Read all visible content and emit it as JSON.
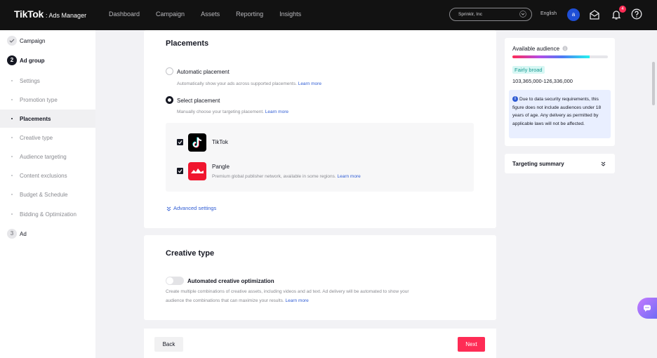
{
  "topbar": {
    "brand": "TikTok",
    "sub": ": Ads Manager",
    "nav": [
      "Dashboard",
      "Campaign",
      "Assets",
      "Reporting",
      "Insights"
    ],
    "account": "Sprinklr, Inc",
    "language": "English",
    "avatar": "a",
    "notification_count": "4"
  },
  "sidebar": {
    "campaign": "Campaign",
    "adgroup_num": "2",
    "adgroup": "Ad group",
    "items": [
      "Settings",
      "Promotion type",
      "Placements",
      "Creative type",
      "Audience targeting",
      "Content exclusions",
      "Budget & Schedule",
      "Bidding & Optimization"
    ],
    "ad_num": "3",
    "ad": "Ad"
  },
  "placements": {
    "title": "Placements",
    "auto_label": "Automatic placement",
    "auto_desc": "Automatically show your ads across supported placements.",
    "select_label": "Select placement",
    "select_desc": "Manually choose your targeting placement.",
    "learn_more": "Learn more",
    "tiktok": "TikTok",
    "pangle": "Pangle",
    "pangle_desc": "Premium global publisher network, available in some regions.",
    "advanced": "Advanced settings"
  },
  "creative": {
    "title": "Creative type",
    "toggle_label": "Automated creative optimization",
    "desc_1": "Create multiple combinations of creative assets, including videos and ad text. Ad delivery will be automated to show your",
    "desc_2": "audience the combinations that can maximize your results.",
    "learn_more": "Learn more"
  },
  "footer": {
    "back": "Back",
    "next": "Next"
  },
  "audience": {
    "title": "Available audience",
    "level": "Fairly broad",
    "level_fraction": 0.81,
    "range": "103,365,000-126,336,000",
    "info": "Due to data security requirements, this figure does not include audiences under 18 years of age. Any delivery as permitted by applicable laws will not be affected.",
    "targeting_summary": "Targeting summary"
  },
  "icons": [
    "chevron-down-icon",
    "mail-icon",
    "bell-icon",
    "help-icon",
    "check-icon",
    "info-icon",
    "chat-icon"
  ],
  "colors": {
    "accent": "#fe2c55",
    "link": "#2f5cd4",
    "topbar": "#121212"
  }
}
